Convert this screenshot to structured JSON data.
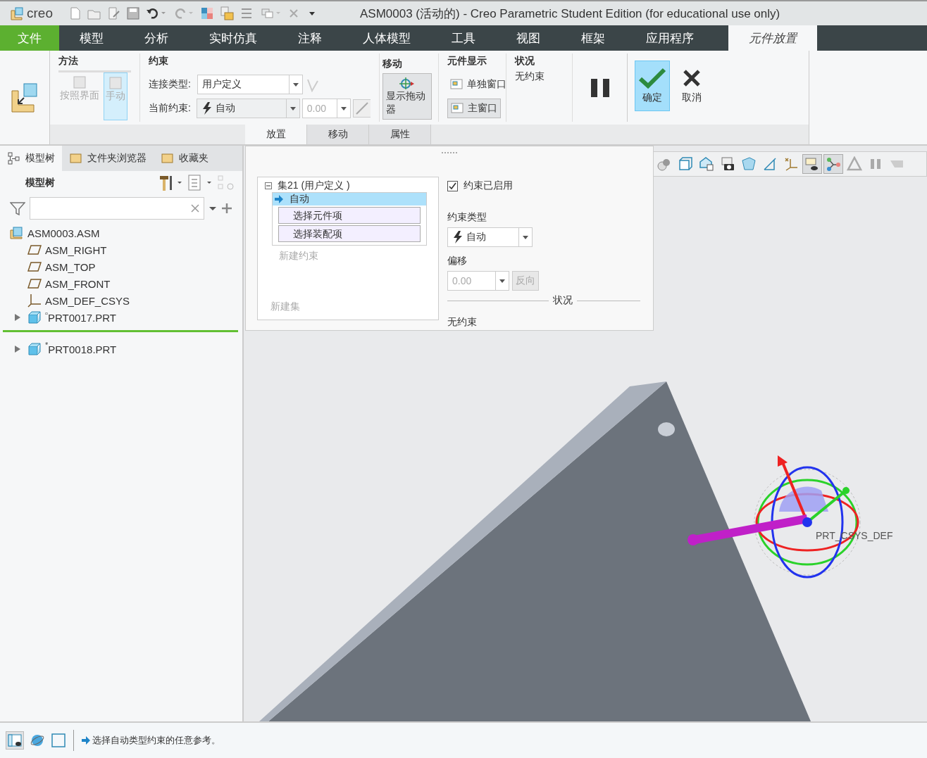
{
  "title_bar": {
    "logo": "creo",
    "title": "ASM0003 (活动的) - Creo Parametric Student Edition (for educational use only)"
  },
  "menu_tabs": [
    {
      "label": "文件",
      "kind": "file",
      "selected": false
    },
    {
      "label": "模型",
      "kind": "tab",
      "selected": false
    },
    {
      "label": "分析",
      "kind": "tab",
      "selected": false
    },
    {
      "label": "实时仿真",
      "kind": "tab",
      "selected": false
    },
    {
      "label": "注释",
      "kind": "tab",
      "selected": false
    },
    {
      "label": "人体模型",
      "kind": "tab",
      "selected": false
    },
    {
      "label": "工具",
      "kind": "tab",
      "selected": false
    },
    {
      "label": "视图",
      "kind": "tab",
      "selected": false
    },
    {
      "label": "框架",
      "kind": "tab",
      "selected": false
    },
    {
      "label": "应用程序",
      "kind": "tab",
      "selected": false
    },
    {
      "label": "元件放置",
      "kind": "tab",
      "selected": true
    }
  ],
  "ribbon": {
    "method": {
      "title": "方法",
      "buttons": [
        {
          "label": "按照界面",
          "selected": false,
          "disabled": true
        },
        {
          "label": "手动",
          "selected": true,
          "disabled": true
        }
      ]
    },
    "constraint": {
      "title": "约束",
      "connection_label": "连接类型:",
      "connection_value": "用户定义",
      "current_label": "当前约束:",
      "current_value": "自动",
      "offset_value": "0.00"
    },
    "move": {
      "title": "移动",
      "button": "显示拖动器"
    },
    "component_display": {
      "title": "元件显示",
      "buttons": [
        {
          "label": "单独窗口",
          "selected": false
        },
        {
          "label": "主窗口",
          "selected": true
        }
      ]
    },
    "status": {
      "title": "状况",
      "text": "无约束"
    },
    "ok": "确定",
    "cancel": "取消"
  },
  "panel_tabs": [
    {
      "label": "放置",
      "selected": true
    },
    {
      "label": "移动",
      "selected": false
    },
    {
      "label": "属性",
      "selected": false
    }
  ],
  "sidebar": {
    "tabs": [
      {
        "label": "模型树",
        "selected": true
      },
      {
        "label": "文件夹浏览器",
        "selected": false
      },
      {
        "label": "收藏夹",
        "selected": false
      }
    ],
    "header": "模型树",
    "tree": [
      {
        "label": "ASM0003.ASM",
        "kind": "assembly",
        "children": [
          {
            "label": "ASM_RIGHT",
            "kind": "plane"
          },
          {
            "label": "ASM_TOP",
            "kind": "plane"
          },
          {
            "label": "ASM_FRONT",
            "kind": "plane"
          },
          {
            "label": "ASM_DEF_CSYS",
            "kind": "csys"
          },
          {
            "label": "PRT0017.PRT",
            "kind": "part",
            "marker": "▫",
            "expanded": false,
            "insert_after": true
          },
          {
            "label": "PRT0018.PRT",
            "kind": "part",
            "marker": "*",
            "expanded": false,
            "insert_after": false
          }
        ]
      }
    ]
  },
  "placement_panel": {
    "set": {
      "label": "集21 (用户定义 )",
      "expanded": true,
      "constraints": [
        {
          "label": "自动",
          "selected": true,
          "references": [
            "选择元件项",
            "选择装配项"
          ]
        }
      ],
      "new_constraint": "新建约束"
    },
    "new_set": "新建集",
    "enabled": {
      "label": "约束已启用",
      "checked": true
    },
    "type_label": "约束类型",
    "type_value": "自动",
    "offset_label": "偏移",
    "offset_value": "0.00",
    "flip": "反向",
    "status_heading": "状况",
    "status_text": "无约束"
  },
  "view_toolbar": [
    {
      "kind": "shade",
      "selected": false
    },
    {
      "kind": "cube",
      "selected": false
    },
    {
      "kind": "box",
      "selected": false
    },
    {
      "kind": "camera",
      "selected": false
    },
    {
      "kind": "wire",
      "selected": false
    },
    {
      "kind": "plane",
      "selected": false
    },
    {
      "kind": "csys",
      "selected": false
    },
    {
      "kind": "display",
      "selected": true
    },
    {
      "kind": "branch",
      "selected": true
    },
    {
      "kind": "triangle",
      "selected": false
    },
    {
      "kind": "pause",
      "selected": false
    },
    {
      "kind": "fade",
      "selected": false
    }
  ],
  "viewport": {
    "csys_label": "PRT_CSYS_DEF"
  },
  "status_bar": {
    "message": "选择自动类型约束的任意参考。"
  }
}
